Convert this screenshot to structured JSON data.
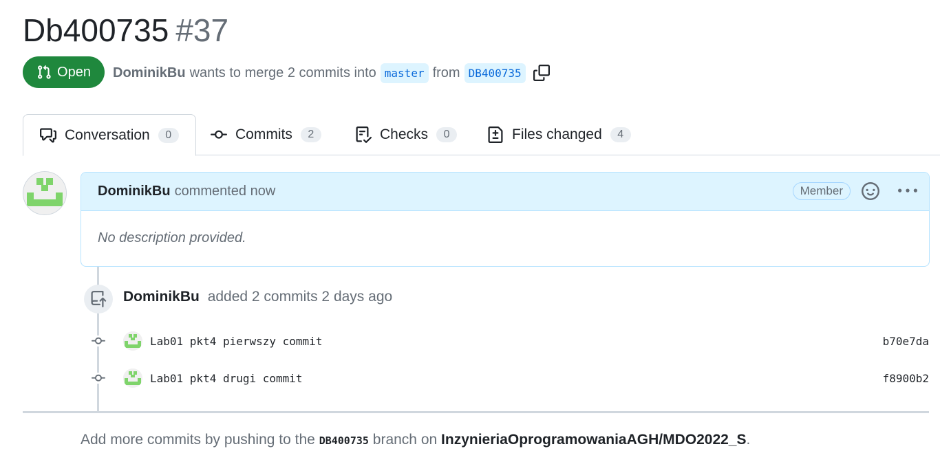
{
  "pr": {
    "title": "Db400735",
    "number": "#37",
    "state": "Open",
    "author": "DominikBu",
    "summary": "wants to merge 2 commits into",
    "base_branch": "master",
    "from_word": "from",
    "head_branch": "DB400735"
  },
  "tabs": [
    {
      "label": "Conversation",
      "count": "0",
      "icon": "comment-discussion-icon"
    },
    {
      "label": "Commits",
      "count": "2",
      "icon": "git-commit-icon"
    },
    {
      "label": "Checks",
      "count": "0",
      "icon": "checklist-icon"
    },
    {
      "label": "Files changed",
      "count": "4",
      "icon": "file-diff-icon"
    }
  ],
  "comment": {
    "author": "DominikBu",
    "action": "commented now",
    "role": "Member",
    "body": "No description provided."
  },
  "event": {
    "author": "DominikBu",
    "text": "added 2 commits 2 days ago"
  },
  "commits": [
    {
      "message": "Lab01 pkt4 pierwszy commit",
      "sha": "b70e7da"
    },
    {
      "message": "Lab01 pkt4 drugi commit",
      "sha": "f8900b2"
    }
  ],
  "hint": {
    "prefix": "Add more commits by pushing to the",
    "branch": "DB400735",
    "middle": "branch on",
    "repo": "InzynieriaOprogramowaniaAGH/MDO2022_S",
    "suffix": "."
  },
  "colors": {
    "open_green": "#1f883d",
    "branch_blue": "#0969da",
    "comment_header_bg": "#ddf4ff",
    "identicon_green": "#7fd46b"
  }
}
